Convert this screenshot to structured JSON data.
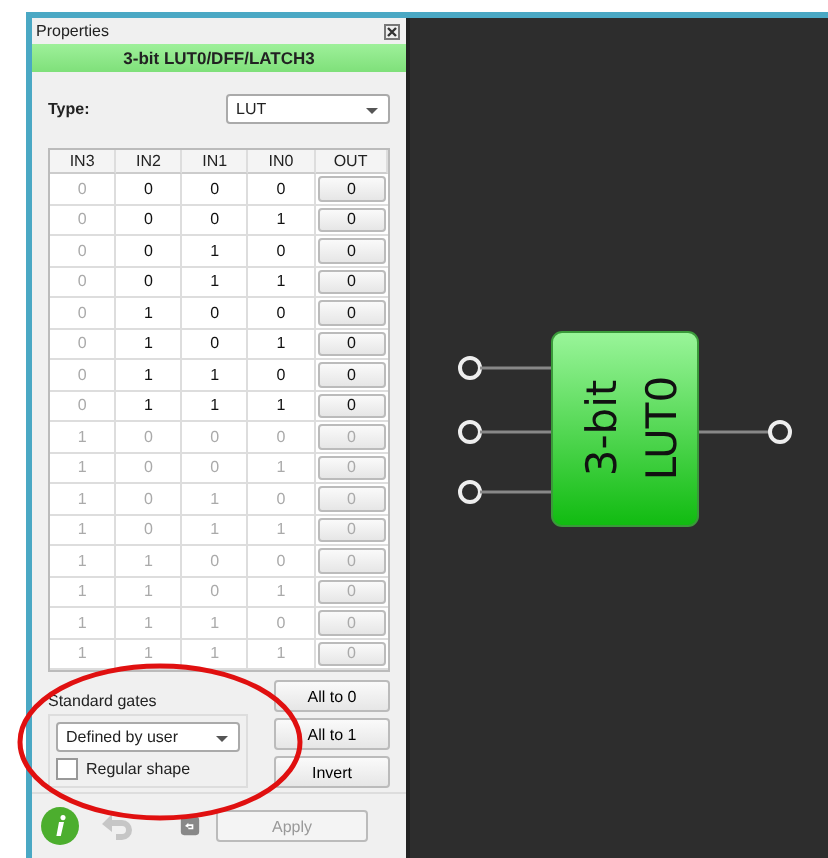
{
  "panel": {
    "title": "Properties",
    "component": "3-bit LUT0/DFF/LATCH3",
    "type_label": "Type:",
    "type_value": "LUT"
  },
  "table": {
    "columns": [
      {
        "label": "IN3",
        "dimmed": true
      },
      {
        "label": "IN2",
        "dimmed": false
      },
      {
        "label": "IN1",
        "dimmed": false
      },
      {
        "label": "IN0",
        "dimmed": false
      }
    ],
    "out_label": "OUT",
    "rows": [
      {
        "cells": [
          "0",
          "0",
          "0",
          "0"
        ],
        "out": "0",
        "enabled": true
      },
      {
        "cells": [
          "0",
          "0",
          "0",
          "1"
        ],
        "out": "0",
        "enabled": true
      },
      {
        "cells": [
          "0",
          "0",
          "1",
          "0"
        ],
        "out": "0",
        "enabled": true
      },
      {
        "cells": [
          "0",
          "0",
          "1",
          "1"
        ],
        "out": "0",
        "enabled": true
      },
      {
        "cells": [
          "0",
          "1",
          "0",
          "0"
        ],
        "out": "0",
        "enabled": true
      },
      {
        "cells": [
          "0",
          "1",
          "0",
          "1"
        ],
        "out": "0",
        "enabled": true
      },
      {
        "cells": [
          "0",
          "1",
          "1",
          "0"
        ],
        "out": "0",
        "enabled": true
      },
      {
        "cells": [
          "0",
          "1",
          "1",
          "1"
        ],
        "out": "0",
        "enabled": true
      },
      {
        "cells": [
          "1",
          "0",
          "0",
          "0"
        ],
        "out": "0",
        "enabled": false
      },
      {
        "cells": [
          "1",
          "0",
          "0",
          "1"
        ],
        "out": "0",
        "enabled": false
      },
      {
        "cells": [
          "1",
          "0",
          "1",
          "0"
        ],
        "out": "0",
        "enabled": false
      },
      {
        "cells": [
          "1",
          "0",
          "1",
          "1"
        ],
        "out": "0",
        "enabled": false
      },
      {
        "cells": [
          "1",
          "1",
          "0",
          "0"
        ],
        "out": "0",
        "enabled": false
      },
      {
        "cells": [
          "1",
          "1",
          "0",
          "1"
        ],
        "out": "0",
        "enabled": false
      },
      {
        "cells": [
          "1",
          "1",
          "1",
          "0"
        ],
        "out": "0",
        "enabled": false
      },
      {
        "cells": [
          "1",
          "1",
          "1",
          "1"
        ],
        "out": "0",
        "enabled": false
      }
    ]
  },
  "standard_gates": {
    "label": "Standard gates",
    "value": "Defined by user",
    "regular_shape": {
      "label": "Regular shape",
      "checked": false
    }
  },
  "buttons": [
    "All to 0",
    "All to 1",
    "Invert"
  ],
  "footer": {
    "undo_disabled": true,
    "apply": "Apply",
    "apply_disabled": true
  },
  "canvas": {
    "block_label": [
      "3-bit",
      "LUT0"
    ]
  }
}
